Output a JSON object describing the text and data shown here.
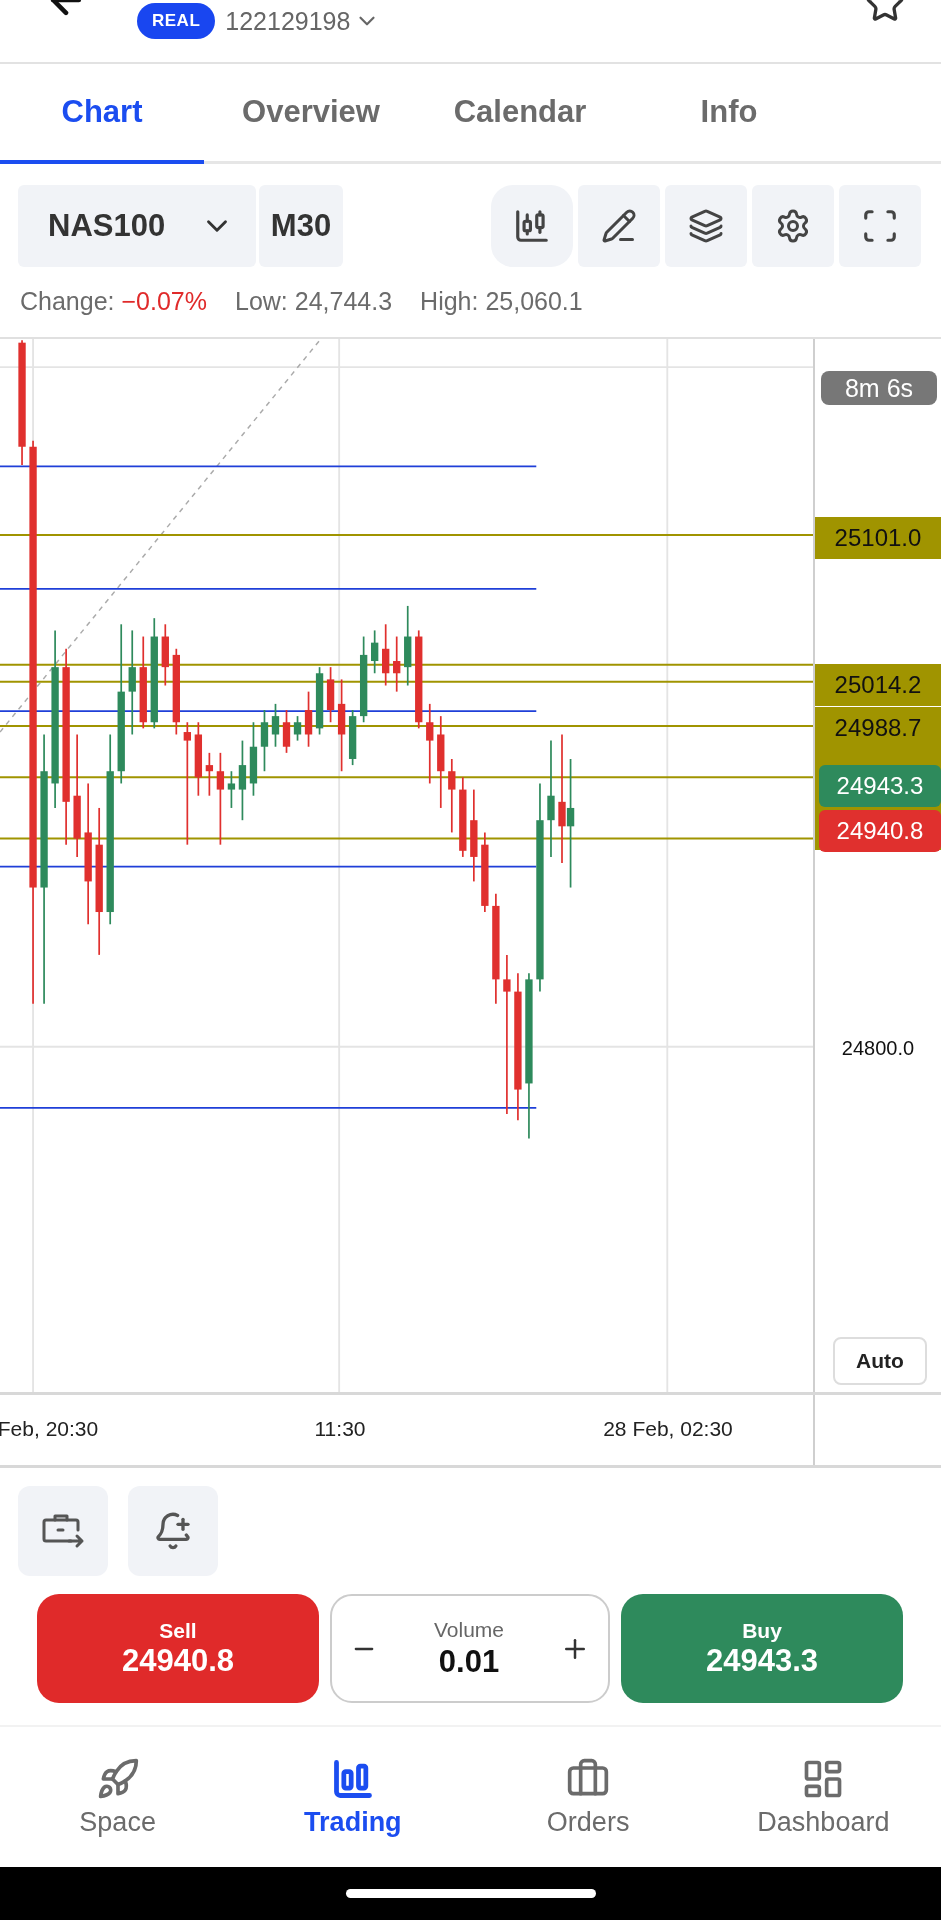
{
  "header": {
    "account_badge": "REAL",
    "account_number": "122129198"
  },
  "tabs": [
    {
      "label": "Chart",
      "selected": true
    },
    {
      "label": "Overview",
      "selected": false
    },
    {
      "label": "Calendar",
      "selected": false
    },
    {
      "label": "Info",
      "selected": false
    }
  ],
  "toolbar": {
    "symbol": "NAS100",
    "timeframe": "M30"
  },
  "stats": [
    {
      "label": "Change:",
      "value": "−0.07%",
      "kind": "negative"
    },
    {
      "label": "Low:",
      "value": "24,744.3",
      "kind": "neutral"
    },
    {
      "label": "High:",
      "value": "25,060.1",
      "kind": "neutral"
    }
  ],
  "price_labels": [
    {
      "text": "8m 6s",
      "kind": "timer"
    },
    {
      "text": "25101.0",
      "kind": "level"
    },
    {
      "text": "25014.2",
      "kind": "level"
    },
    {
      "text": "24988.7",
      "kind": "level"
    },
    {
      "text": "24943.3",
      "kind": "buy"
    },
    {
      "text": "24940.8",
      "kind": "sell"
    },
    {
      "text": "24800.0",
      "kind": "tick"
    }
  ],
  "auto_button": "Auto",
  "time_labels": [
    "Feb, 20:30",
    "11:30",
    "28 Feb, 02:30"
  ],
  "trade": {
    "sell_label": "Sell",
    "sell_price": "24940.8",
    "volume_label": "Volume",
    "volume": "0.01",
    "buy_label": "Buy",
    "buy_price": "24943.3"
  },
  "nav": [
    {
      "label": "Space",
      "selected": false
    },
    {
      "label": "Trading",
      "selected": true
    },
    {
      "label": "Orders",
      "selected": false
    },
    {
      "label": "Dashboard",
      "selected": false
    }
  ]
}
